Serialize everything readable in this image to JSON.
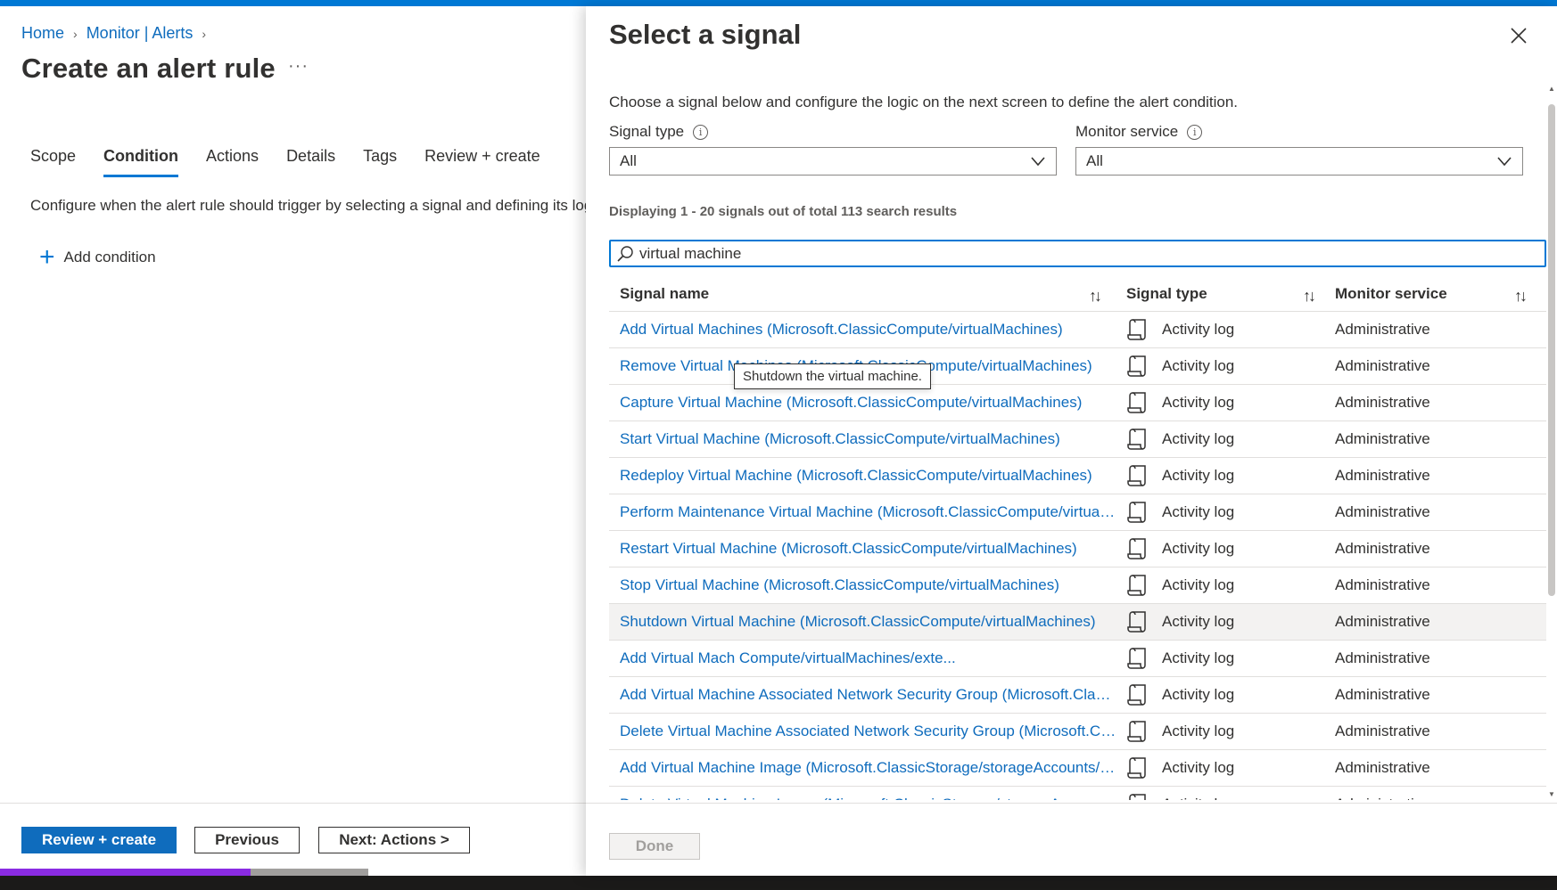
{
  "breadcrumb": {
    "home": "Home",
    "monitor": "Monitor | Alerts"
  },
  "page": {
    "title": "Create an alert rule",
    "more": "···"
  },
  "tabs": [
    "Scope",
    "Condition",
    "Actions",
    "Details",
    "Tags",
    "Review + create"
  ],
  "active_tab": "Condition",
  "condition": {
    "description": "Configure when the alert rule should trigger by selecting a signal and defining its log",
    "add_label": "Add condition"
  },
  "footer": {
    "review_create": "Review + create",
    "previous": "Previous",
    "next": "Next: Actions >",
    "progress_fraction": 0.68
  },
  "panel": {
    "title": "Select a signal",
    "description": "Choose a signal below and configure the logic on the next screen to define the alert condition.",
    "signal_type_label": "Signal type",
    "signal_type_value": "All",
    "monitor_service_label": "Monitor service",
    "monitor_service_value": "All",
    "count_text": "Displaying 1 - 20 signals out of total 113 search results",
    "search_value": "virtual machine",
    "done_label": "Done"
  },
  "grid": {
    "headers": {
      "name": "Signal name",
      "type": "Signal type",
      "service": "Monitor service"
    },
    "rows": [
      {
        "name": "Add Virtual Machines (Microsoft.ClassicCompute/virtualMachines)",
        "type": "Activity log",
        "service": "Administrative"
      },
      {
        "name": "Remove Virtual Machines (Microsoft.ClassicCompute/virtualMachines)",
        "type": "Activity log",
        "service": "Administrative"
      },
      {
        "name": "Capture Virtual Machine (Microsoft.ClassicCompute/virtualMachines)",
        "type": "Activity log",
        "service": "Administrative"
      },
      {
        "name": "Start Virtual Machine (Microsoft.ClassicCompute/virtualMachines)",
        "type": "Activity log",
        "service": "Administrative"
      },
      {
        "name": "Redeploy Virtual Machine (Microsoft.ClassicCompute/virtualMachines)",
        "type": "Activity log",
        "service": "Administrative"
      },
      {
        "name": "Perform Maintenance Virtual Machine (Microsoft.ClassicCompute/virtualMachin...",
        "type": "Activity log",
        "service": "Administrative"
      },
      {
        "name": "Restart Virtual Machine (Microsoft.ClassicCompute/virtualMachines)",
        "type": "Activity log",
        "service": "Administrative"
      },
      {
        "name": "Stop Virtual Machine (Microsoft.ClassicCompute/virtualMachines)",
        "type": "Activity log",
        "service": "Administrative"
      },
      {
        "name": "Shutdown Virtual Machine (Microsoft.ClassicCompute/virtualMachines)",
        "type": "Activity log",
        "service": "Administrative"
      },
      {
        "name": "Add Virtual Mach                              Compute/virtualMachines/exte...",
        "type": "Activity log",
        "service": "Administrative"
      },
      {
        "name": "Add Virtual Machine Associated Network Security Group (Microsoft.ClassicCom...",
        "type": "Activity log",
        "service": "Administrative"
      },
      {
        "name": "Delete Virtual Machine Associated Network Security Group (Microsoft.ClassicCo...",
        "type": "Activity log",
        "service": "Administrative"
      },
      {
        "name": "Add Virtual Machine Image (Microsoft.ClassicStorage/storageAccounts/vmImag...",
        "type": "Activity log",
        "service": "Administrative"
      },
      {
        "name": "Delete Virtual Machine Image (Microsoft.ClassicStorage/storageAccounts/vmIm...",
        "type": "Activity log",
        "service": "Administrative"
      }
    ],
    "hover_row": 8,
    "tooltip": "Shutdown the virtual machine."
  },
  "icons": {
    "chevron": "chevron-right-icon",
    "info": "info-icon",
    "close": "close-icon",
    "search": "search-icon",
    "sort": "sort-icon",
    "activity_log": "activity-log-icon",
    "dropdown": "chevron-down-icon",
    "add": "plus-icon"
  },
  "colors": {
    "accent": "#0078d4",
    "link": "#0f6cbd",
    "progress": "#8a2be2"
  }
}
